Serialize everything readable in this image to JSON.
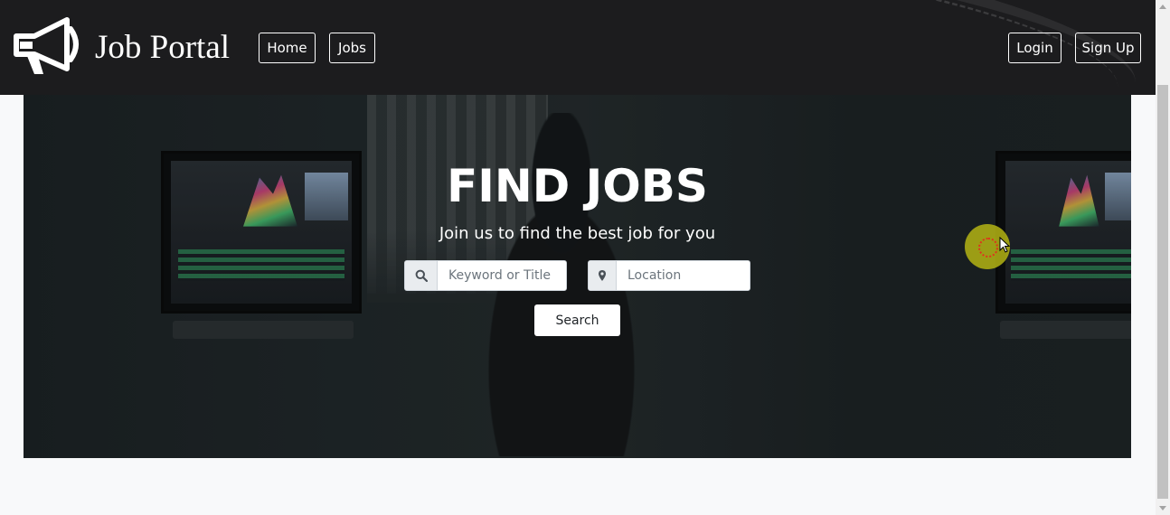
{
  "brand": {
    "title": "Job Portal",
    "logo_icon": "megaphone-icon"
  },
  "nav": {
    "home_label": "Home",
    "jobs_label": "Jobs",
    "login_label": "Login",
    "signup_label": "Sign Up"
  },
  "hero": {
    "title": "FIND JOBS",
    "subtitle": "Join us to find the best job for you",
    "keyword": {
      "icon": "search-icon",
      "placeholder": "Keyword or Title",
      "value": ""
    },
    "location": {
      "icon": "map-marker-icon",
      "placeholder": "Location",
      "value": ""
    },
    "search_label": "Search"
  },
  "colors": {
    "navbar_bg": "#1c1c1e",
    "page_bg": "#f8f9fa",
    "hero_overlay": "#1f2628",
    "addon_bg": "#e9ecef"
  }
}
